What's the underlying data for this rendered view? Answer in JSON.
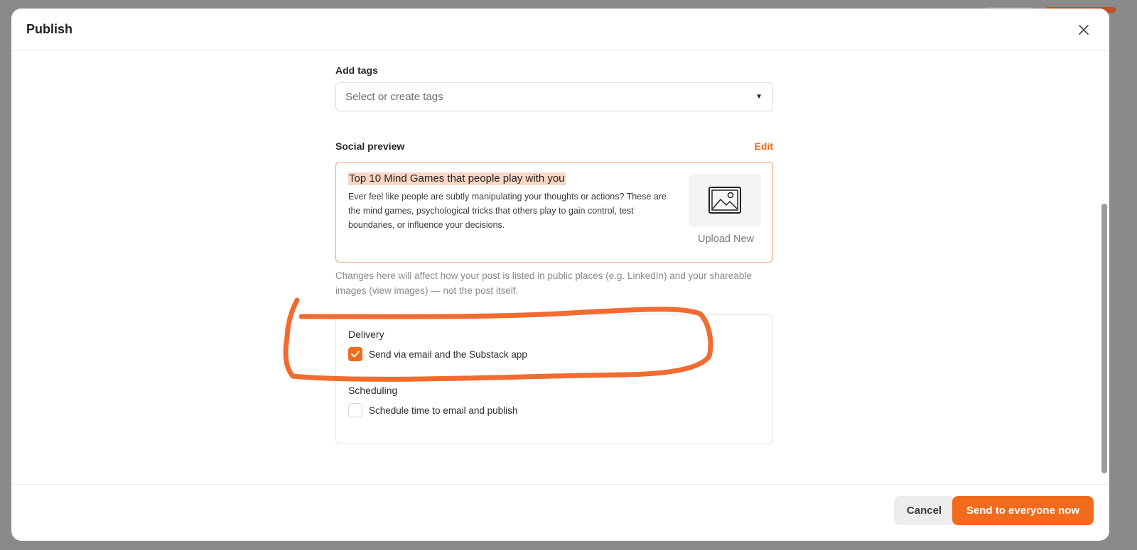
{
  "colors": {
    "accent": "#f26b1d",
    "annotation": "#f26b30"
  },
  "modal": {
    "title": "Publish",
    "close_icon": "close-icon"
  },
  "tags": {
    "label": "Add tags",
    "placeholder": "Select or create tags",
    "dropdown_icon": "caret-down-icon"
  },
  "social_preview": {
    "label": "Social preview",
    "edit_label": "Edit",
    "title": "Top 10 Mind Games that people play with you",
    "description": "Ever feel like people are subtly manipulating your thoughts or actions? These are the mind games, psychological tricks that others play to gain control, test boundaries, or influence your decisions.",
    "image_icon": "image-placeholder-icon",
    "upload_label": "Upload New",
    "helper_text": "Changes here will affect how your post is listed in public places (e.g. LinkedIn) and your shareable images (view images) — not the post itself."
  },
  "delivery": {
    "label": "Delivery",
    "option_label": "Send via email and the Substack app",
    "checked": true
  },
  "scheduling": {
    "label": "Scheduling",
    "option_label": "Schedule time to email and publish",
    "checked": false
  },
  "footer": {
    "cancel_label": "Cancel",
    "send_label": "Send to everyone now"
  }
}
